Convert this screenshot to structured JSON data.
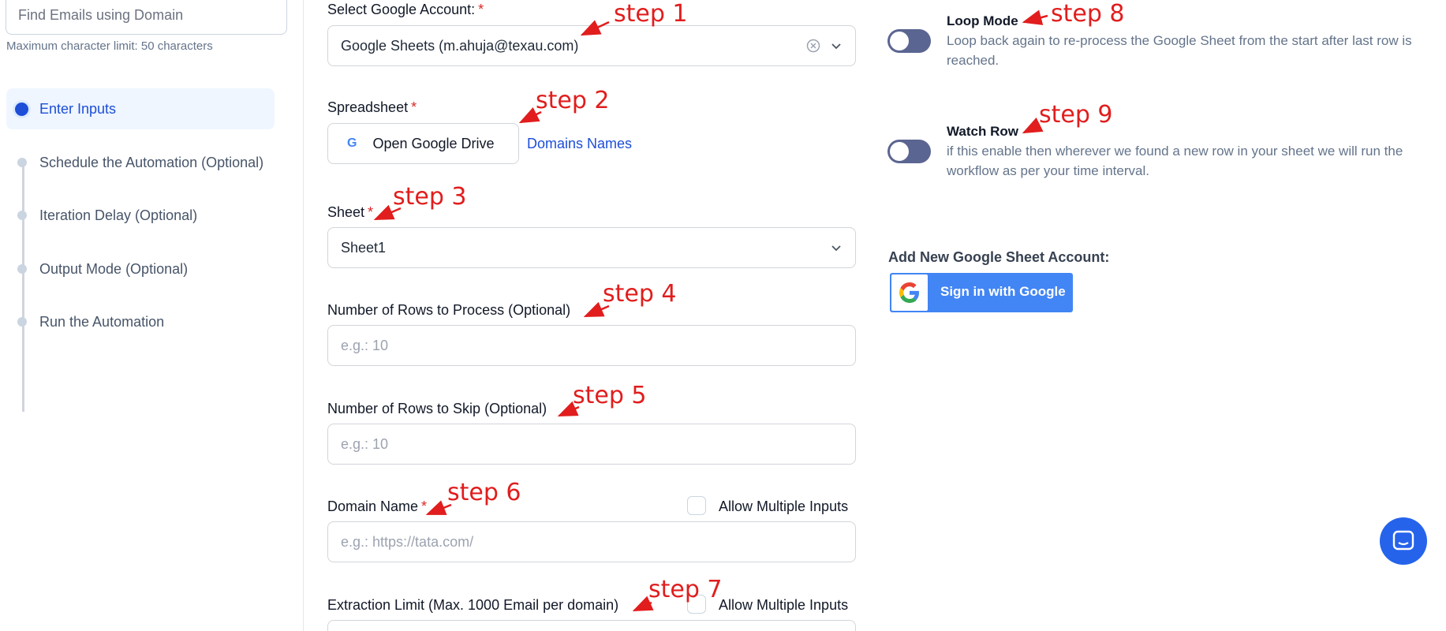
{
  "sidebar": {
    "name_input_value": "Find Emails using Domain",
    "char_limit": "Maximum character limit: 50 characters",
    "steps": [
      {
        "label": "Enter Inputs",
        "active": true
      },
      {
        "label": "Schedule the Automation (Optional)"
      },
      {
        "label": "Iteration Delay (Optional)"
      },
      {
        "label": "Output Mode (Optional)"
      },
      {
        "label": "Run the Automation"
      }
    ]
  },
  "form": {
    "account_label": "Select Google Account:",
    "account_value": "Google Sheets (m.ahuja@texau.com)",
    "spreadsheet_label": "Spreadsheet",
    "open_drive_button": "Open Google Drive",
    "drive_icon_letter": "G",
    "spreadsheet_name": "Domains Names",
    "sheet_label": "Sheet",
    "sheet_value": "Sheet1",
    "rows_process_label": "Number of Rows to Process (Optional)",
    "rows_process_placeholder": "e.g.: 10",
    "rows_skip_label": "Number of Rows to Skip (Optional)",
    "rows_skip_placeholder": "e.g.: 10",
    "domain_label": "Domain Name",
    "domain_placeholder": "e.g.: https://tata.com/",
    "allow_multiple_label": "Allow Multiple Inputs",
    "extraction_label": "Extraction Limit (Max. 1000 Email per domain)",
    "required_mark": "*"
  },
  "options": {
    "loop_title": "Loop Mode",
    "loop_desc": "Loop back again to re-process the Google Sheet from the start after last row is reached.",
    "watch_title": "Watch Row",
    "watch_desc": "if this enable then wherever we found a new row in your sheet we will run the workflow as per your time interval.",
    "add_account_label": "Add New Google Sheet Account:",
    "sign_in_button": "Sign in with Google"
  },
  "annotations": [
    "step 1",
    "step 2",
    "step 3",
    "step 4",
    "step 5",
    "step 6",
    "step 7",
    "step 8",
    "step 9"
  ],
  "colors": {
    "accent": "#1d4ed8",
    "annotation": "#e11d1d",
    "toggle_off": "#5b6591",
    "google_blue": "#4285f4"
  }
}
